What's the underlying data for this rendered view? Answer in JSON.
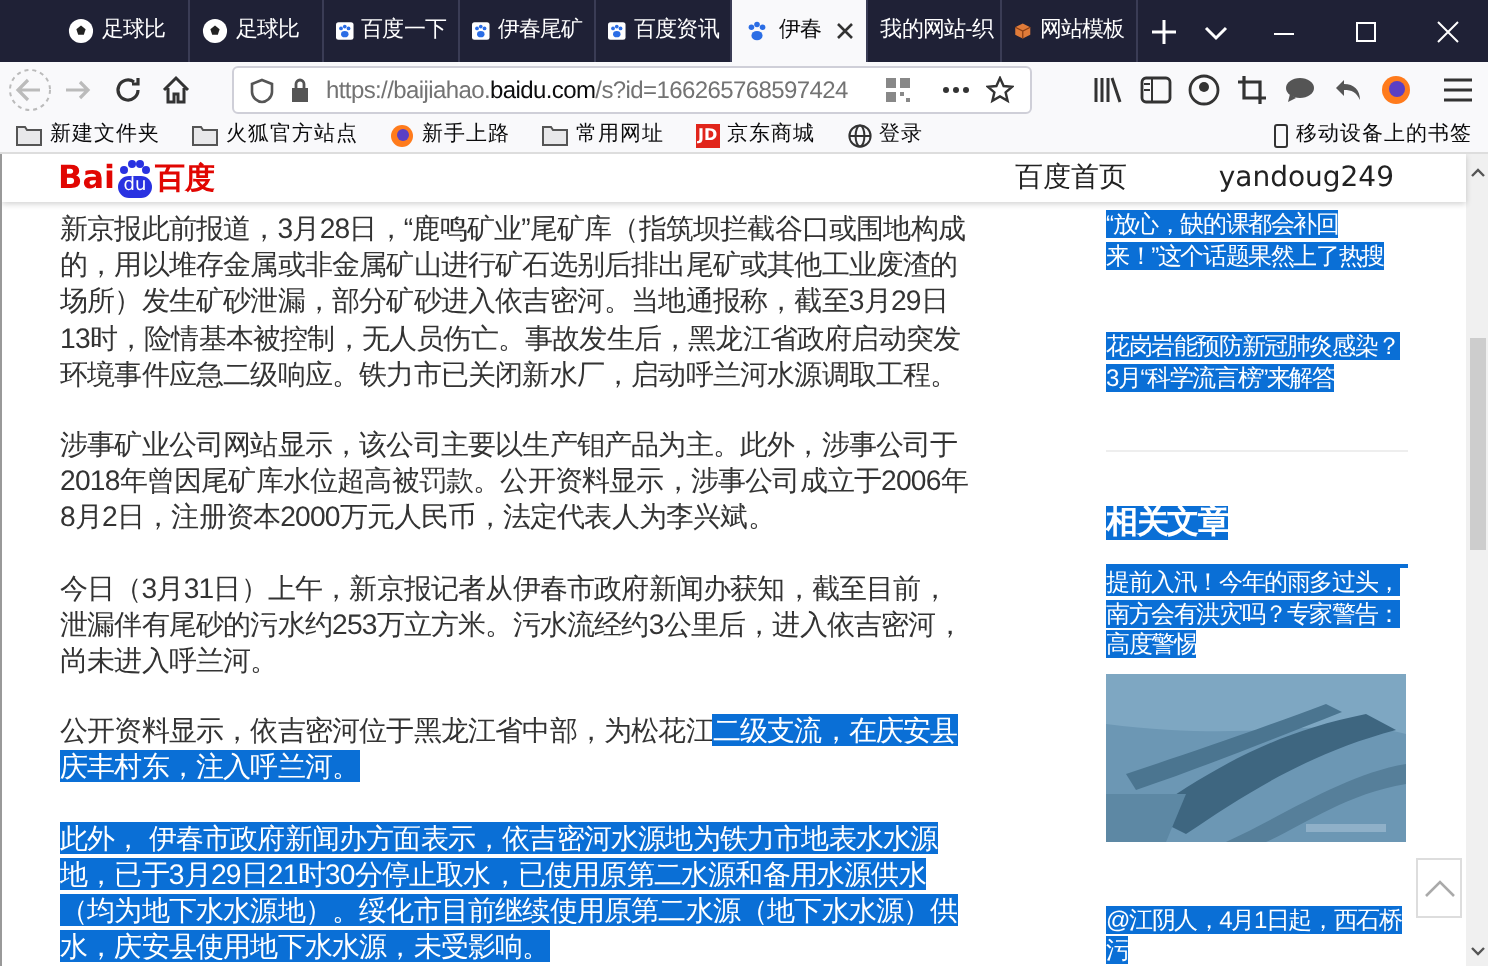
{
  "browser": {
    "tabs": [
      {
        "title": "足球比",
        "kind": "ball",
        "selected": false
      },
      {
        "title": "足球比",
        "kind": "ball",
        "selected": false
      },
      {
        "title": "百度一下",
        "kind": "paw",
        "selected": false
      },
      {
        "title": "伊春尾矿",
        "kind": "paw",
        "selected": false
      },
      {
        "title": "百度资讯",
        "kind": "paw",
        "selected": false
      },
      {
        "title": "伊春",
        "kind": "paw",
        "selected": true
      },
      {
        "title": "我的网站-织",
        "kind": "none",
        "selected": false
      },
      {
        "title": "网站模板",
        "kind": "box",
        "selected": false
      }
    ],
    "url": {
      "prefix": "https://baijiahao.",
      "domain": "baidu.com",
      "path": "/s?id=166265768597424"
    },
    "bookmarks": [
      {
        "label": "新建文件夹",
        "kind": "folder"
      },
      {
        "label": "火狐官方站点",
        "kind": "folder"
      },
      {
        "label": "新手上路",
        "kind": "firefox"
      },
      {
        "label": "常用网址",
        "kind": "folder"
      },
      {
        "label": "京东商城",
        "kind": "jd",
        "badge": "JD"
      },
      {
        "label": "登录",
        "kind": "globe"
      }
    ],
    "mobile_bookmarks": "移动设备上的书签"
  },
  "header": {
    "logo": {
      "left": "Bai",
      "paw": "du",
      "right": "百度"
    },
    "nav": [
      "百度首页",
      "yandoug249"
    ]
  },
  "article": {
    "paragraphs": [
      [
        {
          "text": "新京报此前报道，3月28日，“鹿鸣矿业”尾矿库（指筑坝拦截谷口或围地构成的，用以堆存金属或非金属矿山进行矿石选别后排出尾矿或其他工业废渣的场所）发生矿砂泄漏，部分矿砂进入依吉密河。当地通报称，截至3月29日13时，险情基本被控制，无人员伤亡。事故发生后，黑龙江省政府启动突发环境事件应急二级响应。铁力市已关闭新水厂，启动呼兰河水源调取工程。",
          "selected": false
        }
      ],
      [
        {
          "text": "涉事矿业公司网站显示，该公司主要以生产钼产品为主。此外，涉事公司于2018年曾因尾矿库水位超高被罚款。公开资料显示，涉事公司成立于2006年8月2日，注册资本2000万元人民币，法定代表人为李兴斌。",
          "selected": false
        }
      ],
      [
        {
          "text": "今日（3月31日）上午，新京报记者从伊春市政府新闻办获知，截至目前，泄漏伴有尾砂的污水约253万立方米。污水流经约3公里后，进入依吉密河，尚未进入呼兰河。",
          "selected": false
        }
      ],
      [
        {
          "text": "公开资料显示，依吉密河位于黑龙江省中部，为松花江",
          "selected": false
        },
        {
          "text": "二级支流，在庆安县庆丰村东，注入呼兰河。",
          "selected": true
        }
      ],
      [
        {
          "text": "此外， 伊春市政府新闻办方面表示，依吉密河水源地为铁力市地表水水源地，已于3月29日21时30分停止取水，已使用原第二水源和备用水源供水（均为地下水水源地）。绥化市目前继续使用原第二水源（地下水水源）供水，庆安县使用地下水水源，未受影响。",
          "selected": true
        }
      ]
    ]
  },
  "sidebar": {
    "top_links": [
      {
        "text": "“放心，缺的课都会补回来！”这个话题果然上了热搜",
        "selected": true
      },
      {
        "text": "花岗岩能预防新冠肺炎感染？3月“科学流言榜”来解答",
        "selected": true
      }
    ],
    "heading": {
      "text": "相关文章",
      "selected": true
    },
    "related": [
      {
        "text": "提前入汛！今年的雨多过头，南方会有洪灾吗？专家警告：高度警惕",
        "selected": true,
        "kind": "picture"
      },
      {
        "text": "@江阴人，4月1日起，西石桥污",
        "selected": true
      }
    ]
  }
}
